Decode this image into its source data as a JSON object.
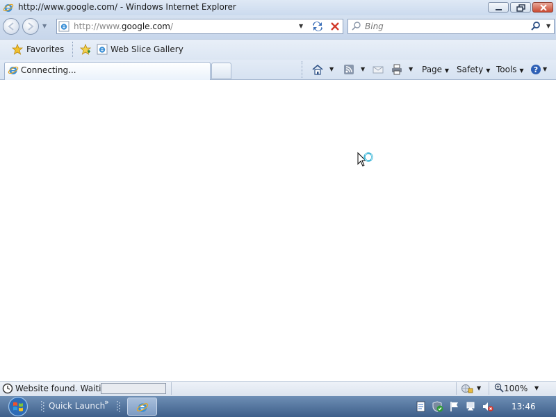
{
  "window": {
    "title": "http://www.google.com/ - Windows Internet Explorer"
  },
  "navbar": {
    "address_value_prefix": "http://www.",
    "address_value_domain": "google.com",
    "address_value_suffix": "/",
    "search_placeholder": "Bing"
  },
  "favorites_bar": {
    "favorites_label": "Favorites",
    "web_slice_label": "Web Slice Gallery"
  },
  "tabs": [
    {
      "label": "Connecting..."
    }
  ],
  "command_bar": {
    "page_label": "Page",
    "safety_label": "Safety",
    "tools_label": "Tools"
  },
  "statusbar": {
    "text": "Website found. Waitin",
    "progress": 0,
    "zoom": "100%"
  },
  "taskbar": {
    "quick_launch_label": "Quick Launch",
    "chevron": "»",
    "clock": "13:46"
  },
  "colors": {
    "chrome": "#d5e1f0",
    "taskbar": "#4b6b96",
    "close_button": "#c94a32"
  }
}
